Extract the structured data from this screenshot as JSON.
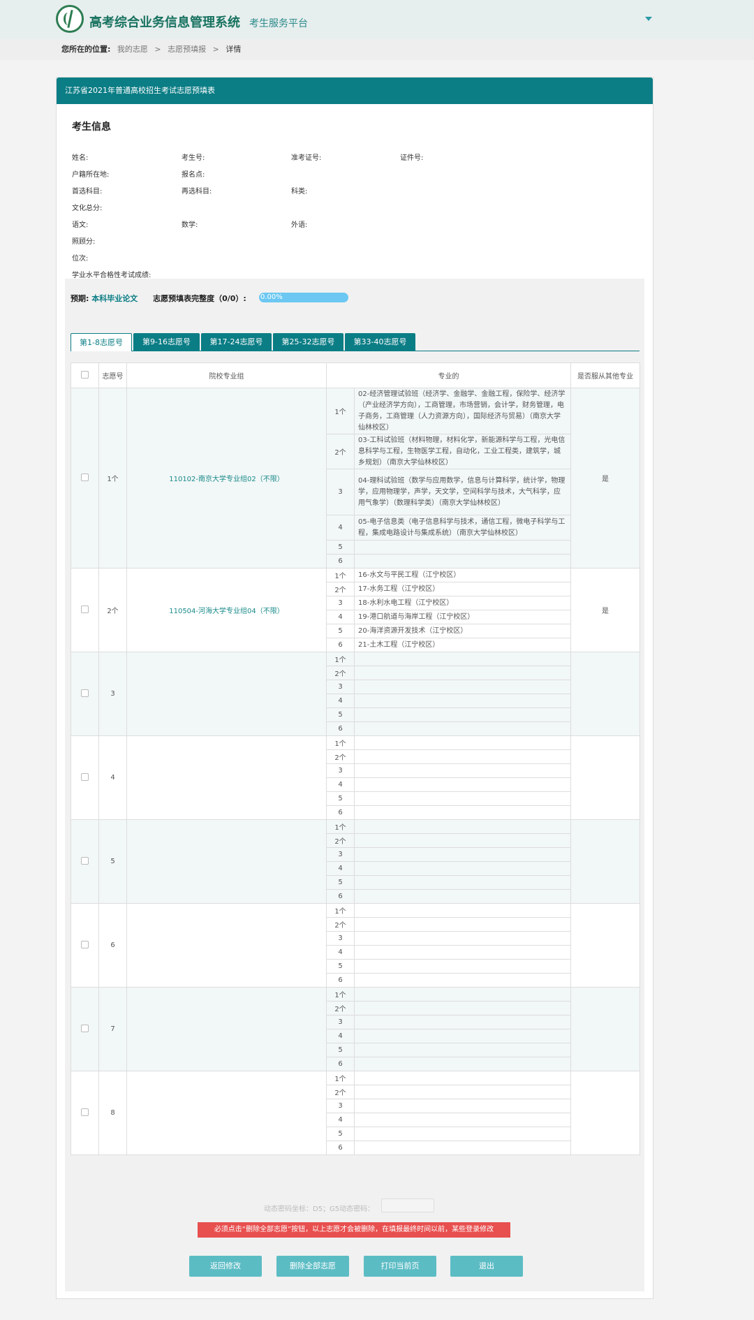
{
  "header": {
    "title": "高考综合业务信息管理系统",
    "subtitle": "考生服务平台"
  },
  "breadcrumb": {
    "label": "您所在的位置:",
    "items": [
      "我的志愿",
      "志愿预填报",
      "详情"
    ]
  },
  "panel": {
    "title": "江苏省2021年普通高校招生考试志愿预填表"
  },
  "student_info": {
    "title": "考生信息",
    "fields": {
      "name": "姓名:",
      "exam_no": "考生号:",
      "admission_no": "准考证号:",
      "id_no": "证件号:",
      "domicile": "户籍所在地:",
      "registration_site": "报名点:",
      "first_subject": "首选科目:",
      "second_subject": "再选科目:",
      "category": "科类:",
      "total_score": "文化总分:",
      "chinese": "语文:",
      "math": "数学:",
      "foreign": "外语:",
      "bonus": "照顾分:",
      "rank": "位次:",
      "academic_test": "学业水平合格性考试成绩:"
    }
  },
  "progress": {
    "period_label": "预期:",
    "period_value": "本科毕业论文",
    "completeness_label": "志愿预填表完整度（0/0）:",
    "percent_text": "0.00%",
    "percent_value": 0
  },
  "tabs": [
    "第1-8志愿号",
    "第9-16志愿号",
    "第17-24志愿号",
    "第25-32志愿号",
    "第33-40志愿号"
  ],
  "table": {
    "headers": {
      "no": "志愿号",
      "group": "院校专业组",
      "major": "专业的",
      "adjust": "是否服从其他专业"
    },
    "rows": [
      {
        "no": "1个",
        "group": "110102-南京大学专业组02（不限）",
        "adjust": "是",
        "majors": [
          {
            "idx": "1个",
            "name": "02-经济管理试验班（经济学、金融学、金融工程，保险学、经济学（产业经济学方向），工商管理，市场营销，会计学，财务管理，电子商务，工商管理（人力资源方向），国际经济与贸易）（南京大学仙林校区）"
          },
          {
            "idx": "2个",
            "name": "03-工科试验班（材料物理，材料化学，新能源科学与工程，光电信息科学与工程，生物医学工程，自动化，工业工程类，建筑学，城乡规划）（南京大学仙林校区）"
          },
          {
            "idx": "3",
            "name": "04-理科试验班（数学与应用数学，信息与计算科学，统计学，物理学，应用物理学，声学，天文学，空间科学与技术，大气科学，应用气象学）（数理科学类）（南京大学仙林校区）"
          },
          {
            "idx": "4",
            "name": "05-电子信息类（电子信息科学与技术，通信工程，微电子科学与工程，集成电路设计与集成系统）（南京大学仙林校区）"
          },
          {
            "idx": "5",
            "name": ""
          },
          {
            "idx": "6",
            "name": ""
          }
        ]
      },
      {
        "no": "2个",
        "group": "110504-河海大学专业组04（不限）",
        "adjust": "是",
        "majors": [
          {
            "idx": "1个",
            "name": "16-水文与平民工程（江宁校区）"
          },
          {
            "idx": "2个",
            "name": "17-水务工程（江宁校区）"
          },
          {
            "idx": "3",
            "name": "18-水利水电工程（江宁校区）"
          },
          {
            "idx": "4",
            "name": "19-港口航道与海岸工程（江宁校区）"
          },
          {
            "idx": "5",
            "name": "20-海洋资源开发技术（江宁校区）"
          },
          {
            "idx": "6",
            "name": "21-土木工程（江宁校区）"
          }
        ]
      },
      {
        "no": "3",
        "group": "",
        "adjust": "",
        "majors": [
          {
            "idx": "1个",
            "name": ""
          },
          {
            "idx": "2个",
            "name": ""
          },
          {
            "idx": "3",
            "name": ""
          },
          {
            "idx": "4",
            "name": ""
          },
          {
            "idx": "5",
            "name": ""
          },
          {
            "idx": "6",
            "name": ""
          }
        ]
      },
      {
        "no": "4",
        "group": "",
        "adjust": "",
        "majors": [
          {
            "idx": "1个",
            "name": ""
          },
          {
            "idx": "2个",
            "name": ""
          },
          {
            "idx": "3",
            "name": ""
          },
          {
            "idx": "4",
            "name": ""
          },
          {
            "idx": "5",
            "name": ""
          },
          {
            "idx": "6",
            "name": ""
          }
        ]
      },
      {
        "no": "5",
        "group": "",
        "adjust": "",
        "majors": [
          {
            "idx": "1个",
            "name": ""
          },
          {
            "idx": "2个",
            "name": ""
          },
          {
            "idx": "3",
            "name": ""
          },
          {
            "idx": "4",
            "name": ""
          },
          {
            "idx": "5",
            "name": ""
          },
          {
            "idx": "6",
            "name": ""
          }
        ]
      },
      {
        "no": "6",
        "group": "",
        "adjust": "",
        "majors": [
          {
            "idx": "1个",
            "name": ""
          },
          {
            "idx": "2个",
            "name": ""
          },
          {
            "idx": "3",
            "name": ""
          },
          {
            "idx": "4",
            "name": ""
          },
          {
            "idx": "5",
            "name": ""
          },
          {
            "idx": "6",
            "name": ""
          }
        ]
      },
      {
        "no": "7",
        "group": "",
        "adjust": "",
        "majors": [
          {
            "idx": "1个",
            "name": ""
          },
          {
            "idx": "2个",
            "name": ""
          },
          {
            "idx": "3",
            "name": ""
          },
          {
            "idx": "4",
            "name": ""
          },
          {
            "idx": "5",
            "name": ""
          },
          {
            "idx": "6",
            "name": ""
          }
        ]
      },
      {
        "no": "8",
        "group": "",
        "adjust": "",
        "majors": [
          {
            "idx": "1个",
            "name": ""
          },
          {
            "idx": "2个",
            "name": ""
          },
          {
            "idx": "3",
            "name": ""
          },
          {
            "idx": "4",
            "name": ""
          },
          {
            "idx": "5",
            "name": ""
          },
          {
            "idx": "6",
            "name": ""
          }
        ]
      }
    ]
  },
  "dynamic_code": {
    "label": "动态密码坐标：D5；G5动态密码："
  },
  "warning": "必须点击“删除全部志愿”按钮，以上志愿才会被删除，在填报最终时间以前，某些登录修改",
  "buttons": {
    "back": "返回修改",
    "delete_all": "删除全部志愿",
    "print": "打印当前页",
    "exit": "退出"
  },
  "colors": {
    "primary": "#0a7d85",
    "header_bg": "#e7eeee",
    "button": "#5cbcc4",
    "warning": "#e84f4f",
    "progress": "#6cc8f2"
  }
}
